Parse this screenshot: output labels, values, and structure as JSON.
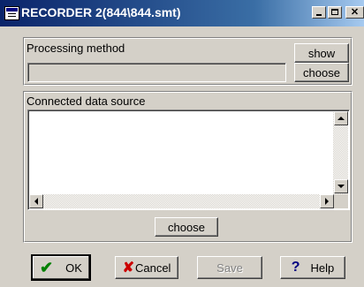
{
  "window": {
    "title": "RECORDER 2(844\\844.smt)"
  },
  "processing": {
    "label": "Processing method",
    "show_label": "show",
    "choose_label": "choose",
    "value": ""
  },
  "datasource": {
    "label": "Connected  data source",
    "choose_label": "choose"
  },
  "footer": {
    "ok_label": "OK",
    "cancel_label": "Cancel",
    "save_label": "Save",
    "help_label": "Help"
  },
  "icons": {
    "ok": "checkmark-icon",
    "cancel": "red-x-icon",
    "help": "question-mark-icon"
  },
  "colors": {
    "titlebar": "#0a246a",
    "ok_check": "#008000",
    "cancel_x": "#cc0000",
    "help_q": "#000080",
    "disabled_text": "#808080"
  }
}
